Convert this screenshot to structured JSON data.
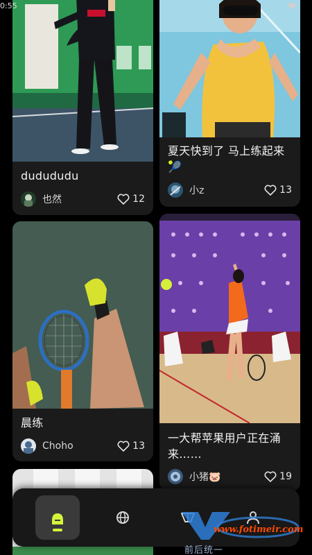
{
  "status_bar": {
    "time": "0:55"
  },
  "feed": {
    "cards": [
      {
        "title": "dudududu",
        "author": "也然",
        "likes": "12"
      },
      {
        "title": "夏天快到了 马上练起来",
        "title_emoji": "🎾",
        "author": "小z",
        "likes": "13"
      },
      {
        "title": "晨练",
        "author": "Choho",
        "likes": "13"
      },
      {
        "title": "一大帮苹果用户正在涌来……",
        "author": "小猪🐷",
        "likes": "19"
      }
    ]
  },
  "bottom_nav": {
    "items": [
      {
        "icon": "home-icon",
        "active": true
      },
      {
        "icon": "globe-icon",
        "active": false
      },
      {
        "icon": "court-icon",
        "active": false
      },
      {
        "icon": "profile-icon",
        "active": false
      }
    ],
    "active_color": "#d4f53c"
  },
  "watermark": {
    "text": "www.fotimeir.com",
    "sub": "前后统一"
  }
}
